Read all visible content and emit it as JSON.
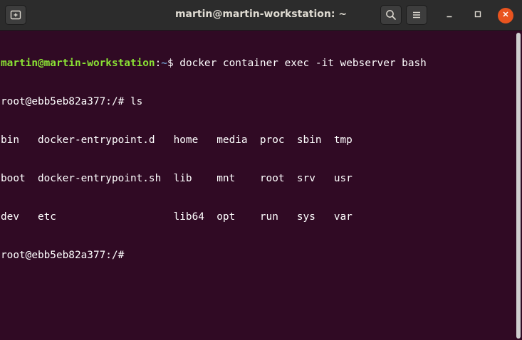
{
  "window": {
    "title": "martin@martin-workstation: ~",
    "icons": {
      "new_tab": "new-tab-icon",
      "search": "search-icon",
      "menu": "hamburger-menu-icon",
      "minimize": "minimize-icon",
      "maximize": "maximize-icon",
      "close": "close-icon"
    },
    "colors": {
      "terminal_bg": "#300a24",
      "titlebar_bg": "#2c2c2c",
      "prompt_user": "#8ae234",
      "prompt_path": "#729fcf",
      "close_button": "#e9541f"
    }
  },
  "terminal": {
    "line1": {
      "user_host": "martin@martin-workstation",
      "separator": ":",
      "path": "~",
      "symbol": "$ ",
      "command": "docker container exec -it webserver bash"
    },
    "line2": "root@ebb5eb82a377:/# ls",
    "ls_output": [
      "bin   docker-entrypoint.d   home   media  proc  sbin  tmp",
      "boot  docker-entrypoint.sh  lib    mnt    root  srv   usr",
      "dev   etc                   lib64  opt    run   sys   var"
    ],
    "line6": "root@ebb5eb82a377:/#"
  }
}
